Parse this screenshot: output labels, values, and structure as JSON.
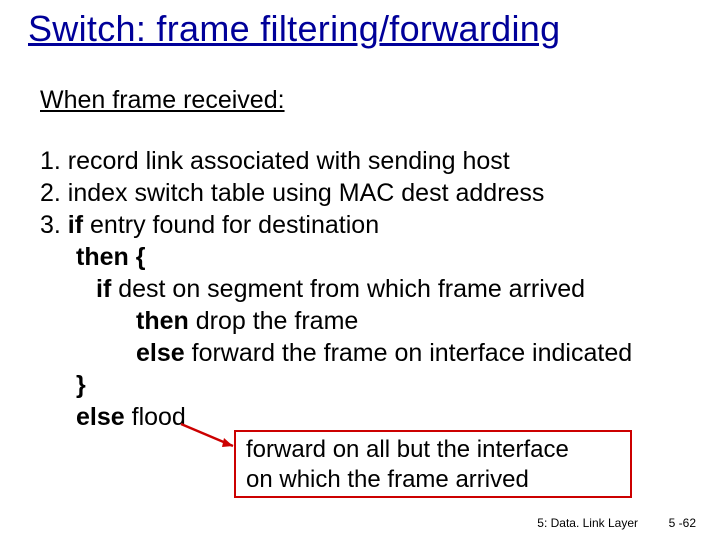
{
  "title": "Switch: frame filtering/forwarding",
  "subhead": "When  frame received:",
  "steps": {
    "s1": "1. record link associated with sending host",
    "s2": "2. index switch table using MAC dest address",
    "s3_prefix": "3. ",
    "s3_if": "if",
    "s3_rest": " entry found for destination",
    "then_open": "then {",
    "inner_if": "if",
    "inner_if_rest": " dest on segment from which frame arrived",
    "inner_then": "then",
    "inner_then_rest": " drop the frame",
    "inner_else": "else",
    "inner_else_rest": " forward the frame on interface indicated",
    "close_brace": "  }",
    "outer_else": "else",
    "outer_else_rest": " flood"
  },
  "callout": {
    "line1": "forward on all but the interface",
    "line2": "on which the frame arrived"
  },
  "footer": {
    "section": "5: Data. Link Layer",
    "page": "5 -62"
  },
  "colors": {
    "title_blue": "#000099",
    "callout_red": "#cc0000"
  }
}
